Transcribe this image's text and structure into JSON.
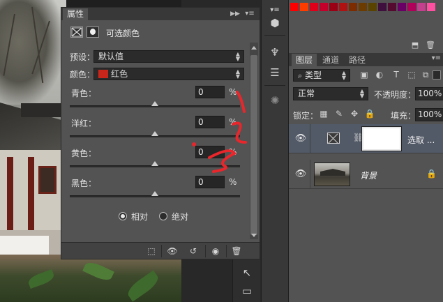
{
  "colors": {
    "panel_bg": "#535353",
    "header_bg": "#383838",
    "field_bg": "#2b2b2b",
    "selected_layer": "#535a67",
    "red_swatch": "#c8261b",
    "annotation_red": "#e8262b"
  },
  "properties": {
    "tab": "属性",
    "title": "可选颜色",
    "preset_label": "预设：",
    "preset_value": "默认值",
    "colors_label": "颜色：",
    "colors_value": "红色",
    "sliders": [
      {
        "name": "青色：",
        "value": "0",
        "unit": "%",
        "level": 0
      },
      {
        "name": "洋红：",
        "value": "0",
        "unit": "%",
        "level": 0
      },
      {
        "name": "黄色：",
        "value": "0",
        "unit": "%",
        "level": 0
      },
      {
        "name": "黑色：",
        "value": "0",
        "unit": "%",
        "level": 0
      }
    ],
    "method_relative": "相对",
    "method_absolute": "绝对",
    "method_selected": "相对"
  },
  "layers_panel": {
    "tabs": [
      "图层",
      "通道",
      "路径"
    ],
    "active_tab": "图层",
    "filter": "类型",
    "blend_mode": "正常",
    "opacity_label": "不透明度：",
    "opacity_value": "100%",
    "lock_label": "锁定：",
    "fill_label": "填充：",
    "fill_value": "100%",
    "layers": [
      {
        "name": "选取 ...",
        "type": "adjustment",
        "visible": true,
        "selected": true
      },
      {
        "name": "背景",
        "type": "image",
        "visible": true,
        "locked": true,
        "selected": false
      }
    ]
  },
  "icons": {
    "visibility": "eye-icon",
    "lock": "lock-icon",
    "delete": "trash-icon",
    "link": "chain-icon"
  }
}
